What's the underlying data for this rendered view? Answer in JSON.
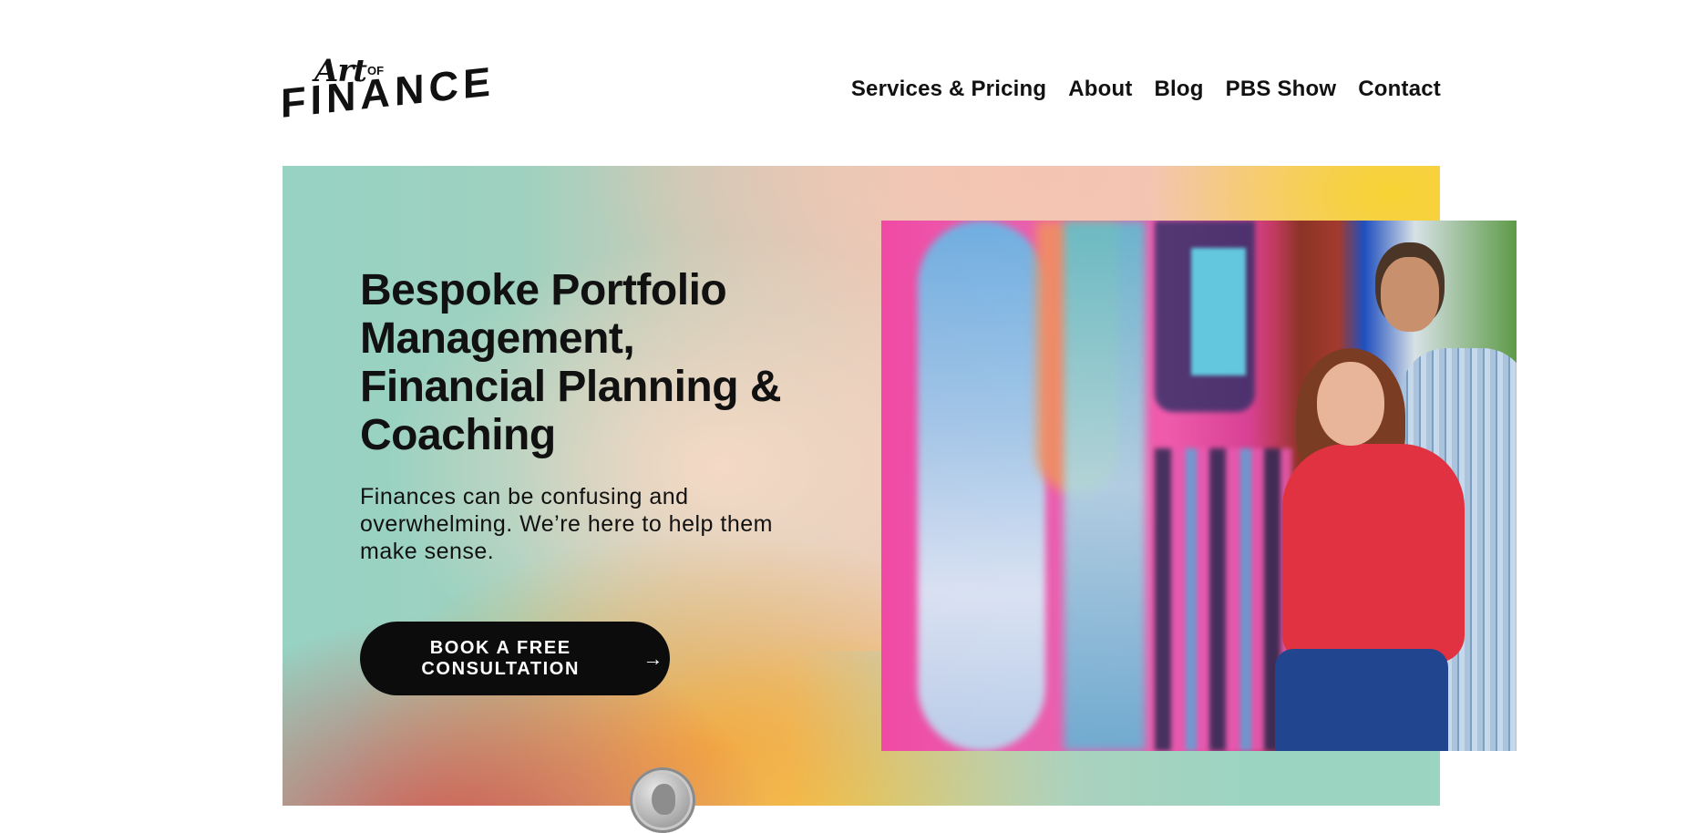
{
  "header": {
    "logo": {
      "line1": "Art",
      "line1_small": "OF",
      "line2": "FINANCE"
    },
    "nav": [
      {
        "label": "Services & Pricing"
      },
      {
        "label": "About"
      },
      {
        "label": "Blog"
      },
      {
        "label": "PBS Show"
      },
      {
        "label": "Contact"
      }
    ]
  },
  "hero": {
    "title": "Bespoke Portfolio Management, Financial Planning & Coaching",
    "subtitle": "Finances can be confusing and overwhelming. We’re here to help them make sense.",
    "cta_label": "BOOK A FREE CONSULTATION",
    "cta_icon": "arrow-right-icon"
  },
  "colors": {
    "text": "#111111",
    "cta_bg": "#0c0c0c",
    "cta_text": "#ffffff",
    "teal": "#97d2c3",
    "peach": "#f3c5b1",
    "yellow": "#f7cf53",
    "coral": "#d64c46"
  }
}
